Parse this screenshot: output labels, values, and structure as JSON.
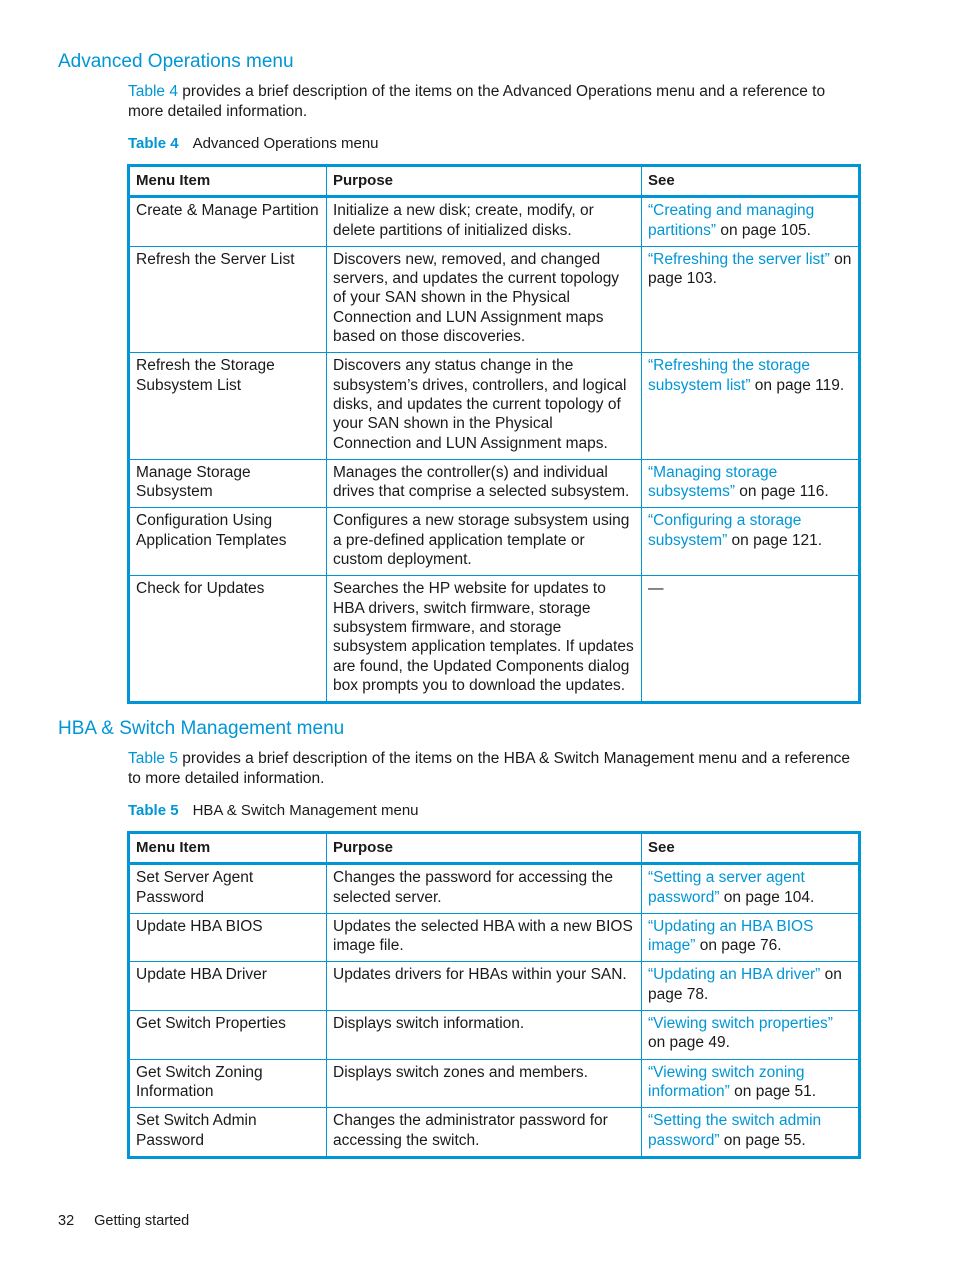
{
  "sections": [
    {
      "heading": "Advanced Operations menu",
      "intro_ref": "Table 4",
      "intro_text": " provides a brief description of the items on the Advanced Operations menu and a reference to more detailed information.",
      "caption_num": "Table 4",
      "caption_title": "Advanced Operations menu",
      "columns": [
        "Menu Item",
        "Purpose",
        "See"
      ],
      "rows": [
        {
          "item": "Create & Manage Partition",
          "purpose": "Initialize a new disk; create, modify, or delete partitions of initialized disks.",
          "see_link": "“Creating and managing partitions”",
          "see_text": " on page 105."
        },
        {
          "item": "Refresh the Server List",
          "purpose": "Discovers new, removed, and changed servers, and updates the current topology of your SAN shown in the Physical Connection and LUN Assignment maps based on those discoveries.",
          "see_link": "“Refreshing the server list”",
          "see_text": " on page 103."
        },
        {
          "item": "Refresh the Storage Subsystem List",
          "purpose": "Discovers any status change in the subsystem’s drives, controllers, and logical disks, and updates the current topology of your SAN shown in the Physical Connection and LUN Assignment maps.",
          "see_link": "“Refreshing the storage subsystem list”",
          "see_text": " on page 119."
        },
        {
          "item": "Manage Storage Subsystem",
          "purpose": "Manages the controller(s) and individual drives that comprise a selected subsystem.",
          "see_link": "“Managing storage subsystems”",
          "see_text": " on page 116."
        },
        {
          "item": "Configuration Using Application Templates",
          "purpose": "Configures a new storage subsystem using a pre-defined application template or custom deployment.",
          "see_link": "“Configuring a storage subsystem”",
          "see_text": " on page 121."
        },
        {
          "item": "Check for Updates",
          "purpose": "Searches the HP website for updates to HBA drivers, switch firmware, storage subsystem firmware, and storage subsystem application templates. If updates are found, the Updated Components dialog box prompts you to download the updates.",
          "see_link": "",
          "see_text": "—"
        }
      ]
    },
    {
      "heading": "HBA & Switch Management menu",
      "intro_ref": "Table 5",
      "intro_text": " provides a brief description of the items on the HBA & Switch Management menu and a reference to more detailed information.",
      "caption_num": "Table 5",
      "caption_title": "HBA & Switch Management menu",
      "columns": [
        "Menu Item",
        "Purpose",
        "See"
      ],
      "rows": [
        {
          "item": "Set Server Agent Password",
          "purpose": "Changes the password for accessing the selected server.",
          "see_link": "“Setting a server agent password”",
          "see_text": " on page 104."
        },
        {
          "item": "Update HBA BIOS",
          "purpose": "Updates the selected HBA with a new BIOS image file.",
          "see_link": "“Updating an HBA BIOS image”",
          "see_text": " on page 76."
        },
        {
          "item": "Update HBA Driver",
          "purpose": "Updates drivers for HBAs within your SAN.",
          "see_link": "“Updating an HBA driver”",
          "see_text": " on page 78."
        },
        {
          "item": "Get Switch Properties",
          "purpose": "Displays switch information.",
          "see_link": "“Viewing switch properties”",
          "see_text": " on page 49."
        },
        {
          "item": "Get Switch Zoning Information",
          "purpose": "Displays switch zones and members.",
          "see_link": "“Viewing switch zoning information”",
          "see_text": " on page 51."
        },
        {
          "item": "Set Switch Admin Password",
          "purpose": "Changes the administrator password for accessing the switch.",
          "see_link": "“Setting the switch admin password”",
          "see_text": " on page 55."
        }
      ]
    }
  ],
  "footer": {
    "page_number": "32",
    "chapter": "Getting started"
  }
}
